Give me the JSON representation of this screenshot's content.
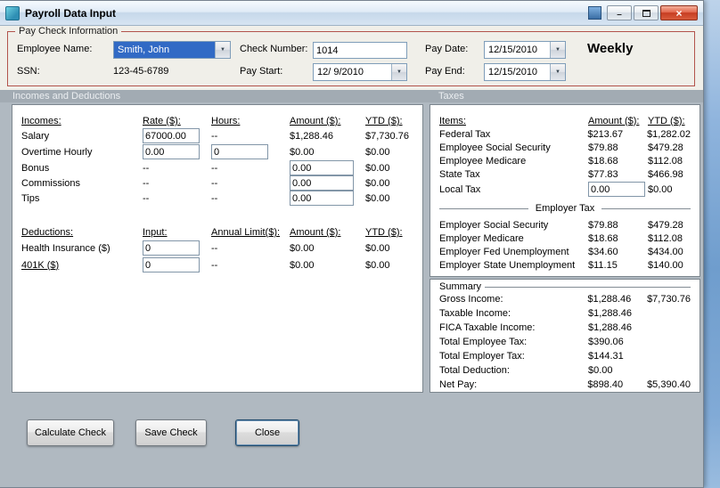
{
  "glyphs": {
    "dropdown_arrow": "▼",
    "minimize": "–",
    "close": "×"
  },
  "window": {
    "title": "Payroll Data Input"
  },
  "paycheck": {
    "legend": "Pay Check Information",
    "employee_name": {
      "label": "Employee Name:",
      "value": "Smith, John"
    },
    "ssn": {
      "label": "SSN:",
      "value": "123-45-6789"
    },
    "check_number": {
      "label": "Check Number:",
      "value": "1014"
    },
    "pay_start": {
      "label": "Pay Start:",
      "value": "12/ 9/2010"
    },
    "pay_date": {
      "label": "Pay Date:",
      "value": "12/15/2010"
    },
    "pay_end": {
      "label": "Pay End:",
      "value": "12/15/2010"
    },
    "frequency": "Weekly"
  },
  "section_headers": {
    "left": "Incomes and Deductions",
    "right": "Taxes"
  },
  "incomes": {
    "headers": {
      "name": "Incomes:",
      "rate": "Rate ($):",
      "hours": "Hours:",
      "amount": "Amount ($):",
      "ytd": "YTD ($):"
    },
    "salary": {
      "label": "Salary",
      "rate": "67000.00",
      "hours": "--",
      "amount": "$1,288.46",
      "ytd": "$7,730.76"
    },
    "overtime": {
      "label": "Overtime Hourly",
      "rate": "0.00",
      "hours": "0",
      "amount": "$0.00",
      "ytd": "$0.00"
    },
    "bonus": {
      "label": "Bonus",
      "rate": "--",
      "hours": "--",
      "amount": "0.00",
      "ytd": "$0.00"
    },
    "commissions": {
      "label": "Commissions",
      "rate": "--",
      "hours": "--",
      "amount": "0.00",
      "ytd": "$0.00"
    },
    "tips": {
      "label": "Tips",
      "rate": "--",
      "hours": "--",
      "amount": "0.00",
      "ytd": "$0.00"
    }
  },
  "deductions": {
    "headers": {
      "name": "Deductions:",
      "input": "Input:",
      "limit": "Annual Limit($):",
      "amount": "Amount ($):",
      "ytd": "YTD ($):"
    },
    "health": {
      "label": "Health Insurance  ($)",
      "input": "0",
      "limit": "--",
      "amount": "$0.00",
      "ytd": "$0.00"
    },
    "k401": {
      "label": "401K  ($)",
      "input": "0",
      "limit": "--",
      "amount": "$0.00",
      "ytd": "$0.00"
    }
  },
  "taxes": {
    "headers": {
      "item": "Items:",
      "amount": "Amount ($):",
      "ytd": "YTD ($):"
    },
    "rows": [
      {
        "item": "Federal Tax",
        "amount": "$213.67",
        "ytd": "$1,282.02"
      },
      {
        "item": "Employee Social Security",
        "amount": "$79.88",
        "ytd": "$479.28"
      },
      {
        "item": "Employee Medicare",
        "amount": "$18.68",
        "ytd": "$112.08"
      },
      {
        "item": "State Tax",
        "amount": "$77.83",
        "ytd": "$466.98"
      }
    ],
    "local_tax": {
      "item": "Local Tax",
      "amount": "0.00",
      "ytd": "$0.00"
    },
    "employer_separator": "Employer Tax",
    "employer_rows": [
      {
        "item": "Employer Social Security",
        "amount": "$79.88",
        "ytd": "$479.28"
      },
      {
        "item": "Employer Medicare",
        "amount": "$18.68",
        "ytd": "$112.08"
      },
      {
        "item": "Employer Fed Unemployment",
        "amount": "$34.60",
        "ytd": "$434.00"
      },
      {
        "item": "Employer State Unemployment",
        "amount": "$11.15",
        "ytd": "$140.00"
      }
    ]
  },
  "summary": {
    "legend": "Summary",
    "rows": [
      {
        "label": "Gross Income:",
        "amount": "$1,288.46",
        "ytd": "$7,730.76"
      },
      {
        "label": "Taxable Income:",
        "amount": "$1,288.46",
        "ytd": ""
      },
      {
        "label": "FICA Taxable Income:",
        "amount": "$1,288.46",
        "ytd": ""
      },
      {
        "label": "Total Employee Tax:",
        "amount": "$390.06",
        "ytd": ""
      },
      {
        "label": "Total Employer Tax:",
        "amount": "$144.31",
        "ytd": ""
      },
      {
        "label": "Total Deduction:",
        "amount": "$0.00",
        "ytd": ""
      },
      {
        "label": "Net Pay:",
        "amount": "$898.40",
        "ytd": "$5,390.40"
      }
    ]
  },
  "buttons": {
    "calculate": "Calculate Check",
    "save": "Save Check",
    "close": "Close"
  },
  "colors": {
    "group_border": "#B2544C",
    "selection": "#316AC5",
    "close_red": "#C63D22",
    "panel_bg": "#B0B9C1"
  }
}
